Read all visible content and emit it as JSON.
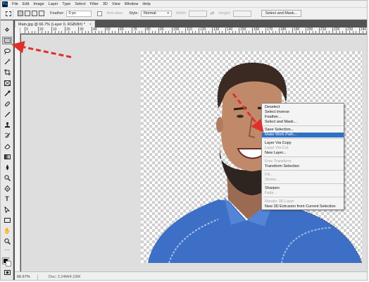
{
  "app": {
    "logo": "Ps"
  },
  "menubar": {
    "items": [
      "File",
      "Edit",
      "Image",
      "Layer",
      "Type",
      "Select",
      "Filter",
      "3D",
      "View",
      "Window",
      "Help"
    ]
  },
  "options": {
    "feather_label": "Feather:",
    "feather_value": "0 px",
    "anti_alias_label": "Anti-alias",
    "style_label": "Style:",
    "style_value": "Normal",
    "width_label": "Width:",
    "height_label": "Height:",
    "select_mask_label": "Select and Mask..."
  },
  "document": {
    "tab_title": "Main.jpg @ 66.7% (Layer 0, RGB/8#) *",
    "tab_close": "×",
    "ruler_labels": [
      "0",
      "20",
      "10",
      "20",
      "30",
      "40",
      "50",
      "60",
      "70",
      "80",
      "90",
      "100",
      "110",
      "120",
      "130",
      "140",
      "150",
      "160",
      "170",
      "180",
      "190",
      "200",
      "210",
      "220",
      "230",
      "240",
      "250"
    ]
  },
  "status": {
    "zoom": "66.67%",
    "doc_info": "Doc: 2.24M/4.19M"
  },
  "context_menu": {
    "items": [
      {
        "label": "Deselect",
        "state": "normal"
      },
      {
        "label": "Select Inverse",
        "state": "normal"
      },
      {
        "label": "Feather...",
        "state": "normal"
      },
      {
        "label": "Select and Mask...",
        "state": "normal"
      },
      {
        "label": "Save Selection...",
        "state": "normal"
      },
      {
        "label": "Make Work Path...",
        "state": "highlight"
      },
      {
        "label": "Layer Via Copy",
        "state": "normal"
      },
      {
        "label": "Layer Via Cut",
        "state": "disabled"
      },
      {
        "label": "New Layer...",
        "state": "normal"
      },
      {
        "label": "Free Transform",
        "state": "disabled"
      },
      {
        "label": "Transform Selection",
        "state": "normal"
      },
      {
        "label": "Fill...",
        "state": "disabled"
      },
      {
        "label": "Stroke...",
        "state": "disabled"
      },
      {
        "label": "Sharpen",
        "state": "normal"
      },
      {
        "label": "Fade...",
        "state": "disabled"
      },
      {
        "label": "Render 3D Layer",
        "state": "disabled"
      },
      {
        "label": "New 3D Extrusion from Current Selection",
        "state": "normal"
      }
    ]
  },
  "colors": {
    "highlight": "#3171c4",
    "annotation_arrow": "#e0302a",
    "foreground": "#000000",
    "background": "#ffffff"
  },
  "tools": [
    "move-icon",
    "rectangular-marquee-icon",
    "lasso-icon",
    "magic-wand-icon",
    "crop-icon",
    "frame-icon",
    "eyedropper-icon",
    "healing-brush-icon",
    "brush-icon",
    "clone-stamp-icon",
    "history-brush-icon",
    "eraser-icon",
    "gradient-icon",
    "blur-icon",
    "dodge-icon",
    "pen-icon",
    "type-icon",
    "path-selection-icon",
    "rectangle-icon",
    "hand-icon",
    "zoom-icon",
    "more-tools-icon",
    "default-colors-icon",
    "quick-mask-icon",
    "screen-mode-icon"
  ]
}
